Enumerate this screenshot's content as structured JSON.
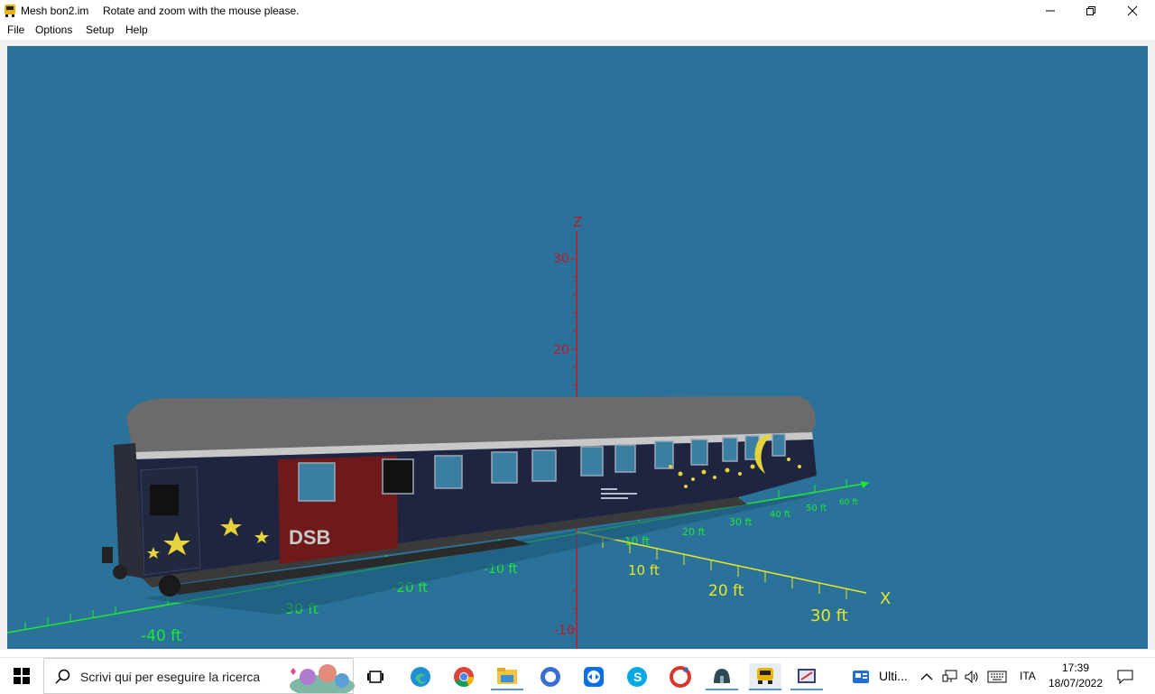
{
  "window": {
    "title": "Mesh bon2.im",
    "message": "Rotate and zoom with the mouse please."
  },
  "menu": {
    "items": [
      "File",
      "Options",
      "Setup",
      "Help"
    ]
  },
  "scene": {
    "z_axis_label": "Z",
    "x_axis_label": "X",
    "z_ticks": [
      "30",
      "20",
      "-10"
    ],
    "x_ticks": [
      "10 ft",
      "20 ft",
      "30 ft"
    ],
    "y_ticks_front": [
      "-40 ft",
      "-30 ft",
      "-20 ft",
      "-10 ft"
    ],
    "y_ticks_back": [
      "10 ft",
      "20 ft",
      "30 ft",
      "40 ft",
      "50 ft",
      "60 ft"
    ],
    "car_logo": "DSB",
    "colors": {
      "background": "#2a7299",
      "axis_z": "#c0182a",
      "axis_grid": "#1fe830",
      "axis_x": "#e6e62a",
      "car_body": "#1f2540",
      "car_roof": "#6b6b6b",
      "logo_panel": "#6e1a1a"
    }
  },
  "taskbar": {
    "search_placeholder": "Scrivi qui per eseguire la ricerca",
    "pinned_label": "Ulti...",
    "language": "ITA",
    "time": "17:39",
    "date": "18/07/2022"
  }
}
